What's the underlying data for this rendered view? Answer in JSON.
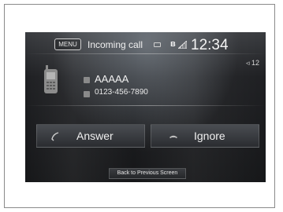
{
  "header": {
    "menu_label": "MENU",
    "title": "Incoming call",
    "bluetooth_glyph": "ʙ",
    "clock": "12:34",
    "icons": [
      "battery-icon",
      "bluetooth-icon",
      "signal-icon"
    ]
  },
  "volume": {
    "glyph": "◃",
    "level": "12"
  },
  "caller": {
    "name": "AAAAA",
    "number": "0123-456-7890"
  },
  "actions": {
    "answer_label": "Answer",
    "ignore_label": "Ignore",
    "back_label": "Back to Previous Screen"
  },
  "colors": {
    "screen_bg": "#1f2023",
    "text": "#f0f0f0",
    "button_top": "#4a4d52",
    "button_bottom": "#2a2c30"
  }
}
